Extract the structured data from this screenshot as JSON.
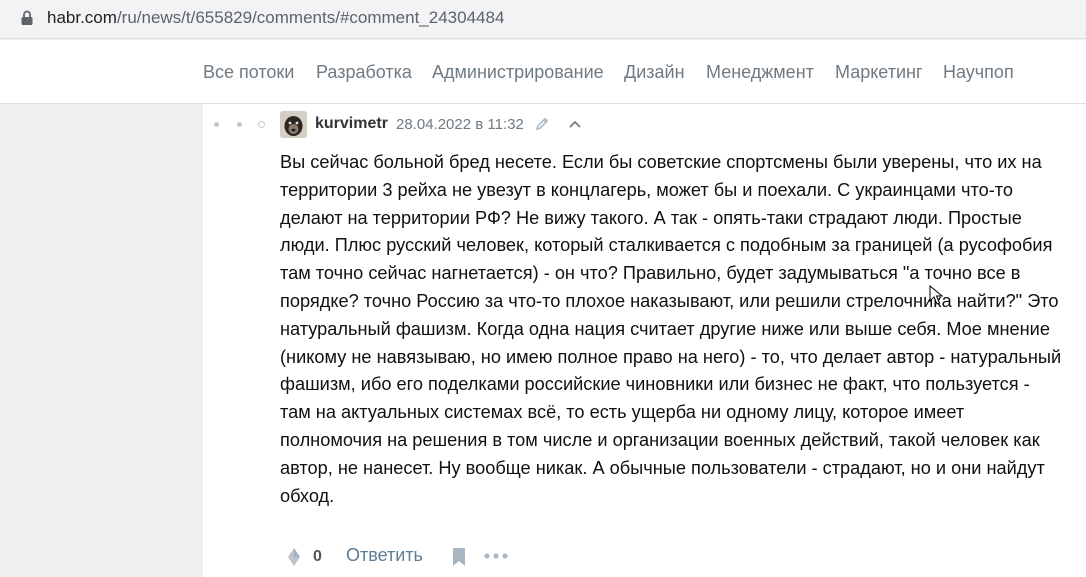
{
  "browser": {
    "url_host": "habr.com",
    "url_path": "/ru/news/t/655829/comments/#comment_24304484"
  },
  "nav": {
    "items": [
      "Все потоки",
      "Разработка",
      "Администрирование",
      "Дизайн",
      "Менеджмент",
      "Маркетинг",
      "Научпоп"
    ]
  },
  "comment": {
    "username": "kurvimetr",
    "date": "28.04.2022 в 11:32",
    "text": "Вы сейчас больной бред несете. Если бы советские спортсмены были уверены, что их на территории 3 рейха не увезут в концлагерь, может бы и поехали. С украинцами что-то делают на территории РФ? Не вижу такого. А так - опять-таки страдают люди. Простые люди. Плюс русский человек, который сталкивается с подобным за границей (а русофобия там точно сейчас нагнетается) - он что? Правильно, будет задумываться \"а точно все в порядке? точно Россию за что-то плохое наказывают, или решили стрелочника найти?\" Это натуральный фашизм. Когда одна нация считает другие ниже или выше себя. Мое мнение (никому не навязываю, но имею полное право на него) - то, что делает автор - натуральный фашизм, ибо его поделками российские чиновники или бизнес не факт, что пользуется - там на актуальных системах всё, то есть ущерба ни одному лицу, которое имеет полномочия на решения в том числе и организации военных действий, такой человек как автор, не нанесет. Ну вообще никак. А обычные пользователи - страдают, но и они найдут обход.",
    "score": "0",
    "reply_label": "Ответить"
  }
}
